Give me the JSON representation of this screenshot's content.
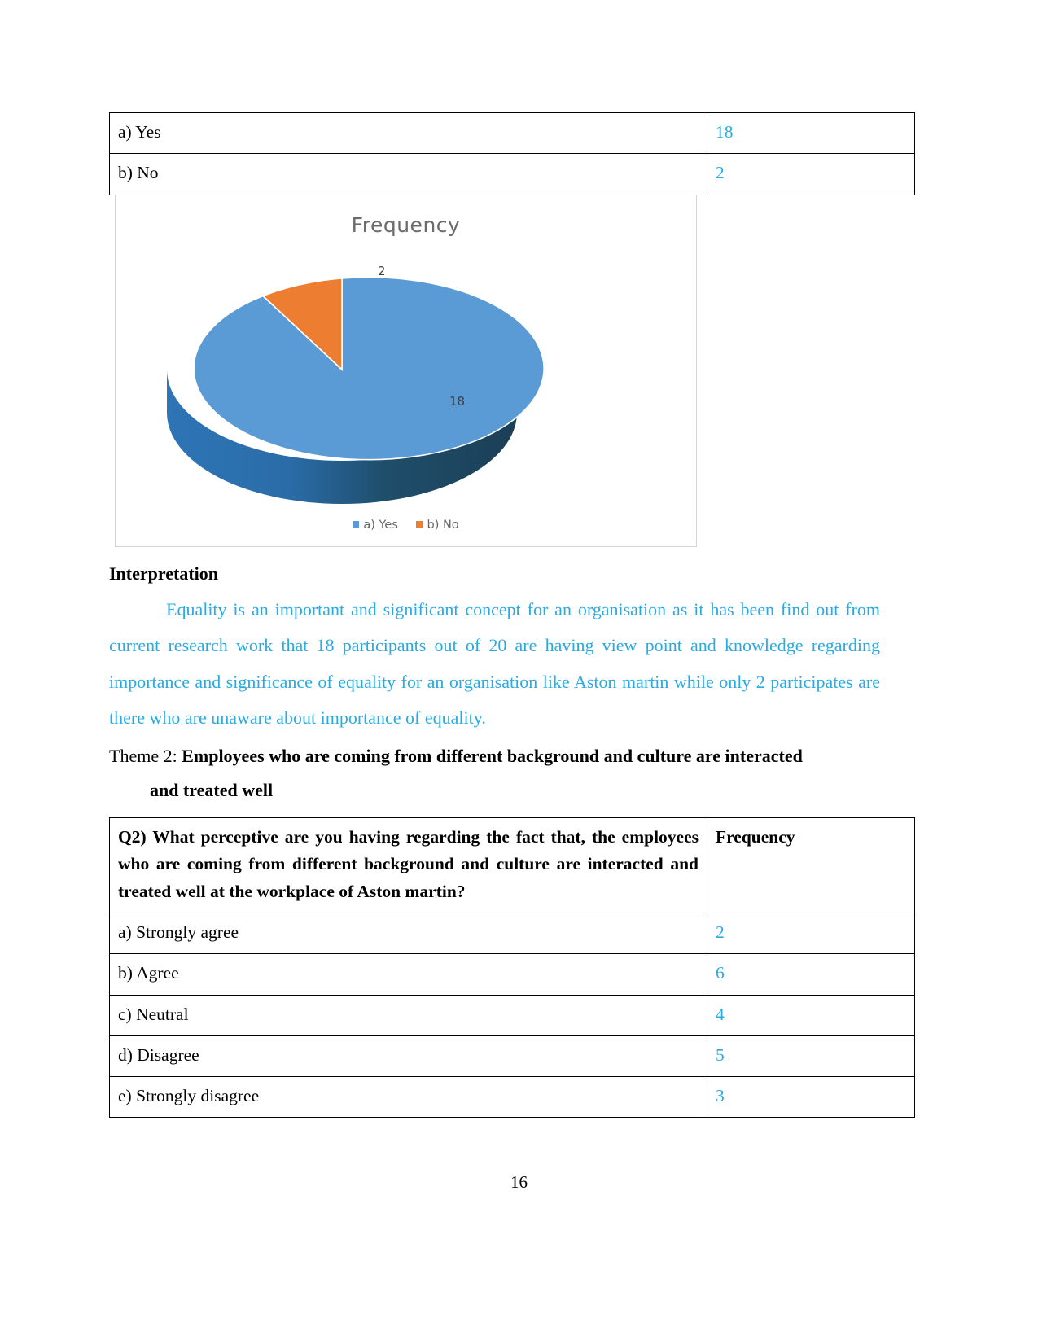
{
  "document": {
    "page_number": "16"
  },
  "table_q1": {
    "rows": [
      {
        "label": "a) Yes",
        "frequency": "18"
      },
      {
        "label": "b) No",
        "frequency": "2"
      }
    ]
  },
  "chart": {
    "title": "Frequency",
    "data_labels": {
      "yes": "2",
      "no": "18"
    },
    "legend": [
      {
        "label": "a) Yes",
        "color": "#5B9BD5"
      },
      {
        "label": "b) No",
        "color": "#ED7D31"
      }
    ]
  },
  "chart_data": {
    "type": "pie",
    "title": "Frequency",
    "categories": [
      "a) Yes",
      "b) No"
    ],
    "values": [
      18,
      2
    ],
    "labels": [
      "18",
      "2"
    ],
    "colors": [
      "#5B9BD5",
      "#ED7D31"
    ],
    "total": 20,
    "three_d": true,
    "legend_position": "bottom",
    "xlabel": "",
    "ylabel": ""
  },
  "interpretation": {
    "heading": "Interpretation",
    "body": "Equality is an important and significant concept for an organisation as it has been find out from current research work that 18 participants out of 20 are having view point and knowledge regarding importance and significance of equality for an organisation like Aston martin while only 2 participates are there who are unaware about importance of equality."
  },
  "theme": {
    "prefix": "Theme 2: ",
    "title": "Employees who are coming from different background and culture are interacted",
    "title_cont": "and treated well"
  },
  "table_q2": {
    "question": "Q2) What perceptive are you having regarding the fact that, the employees who are coming from different background and culture are interacted and treated well at the workplace of Aston martin?",
    "frequency_header": "Frequency",
    "rows": [
      {
        "label": "a) Strongly agree",
        "frequency": "2"
      },
      {
        "label": "b) Agree",
        "frequency": "6"
      },
      {
        "label": "c) Neutral",
        "frequency": "4"
      },
      {
        "label": "d) Disagree",
        "frequency": "5"
      },
      {
        "label": "e) Strongly disagree",
        "frequency": "3"
      }
    ]
  }
}
